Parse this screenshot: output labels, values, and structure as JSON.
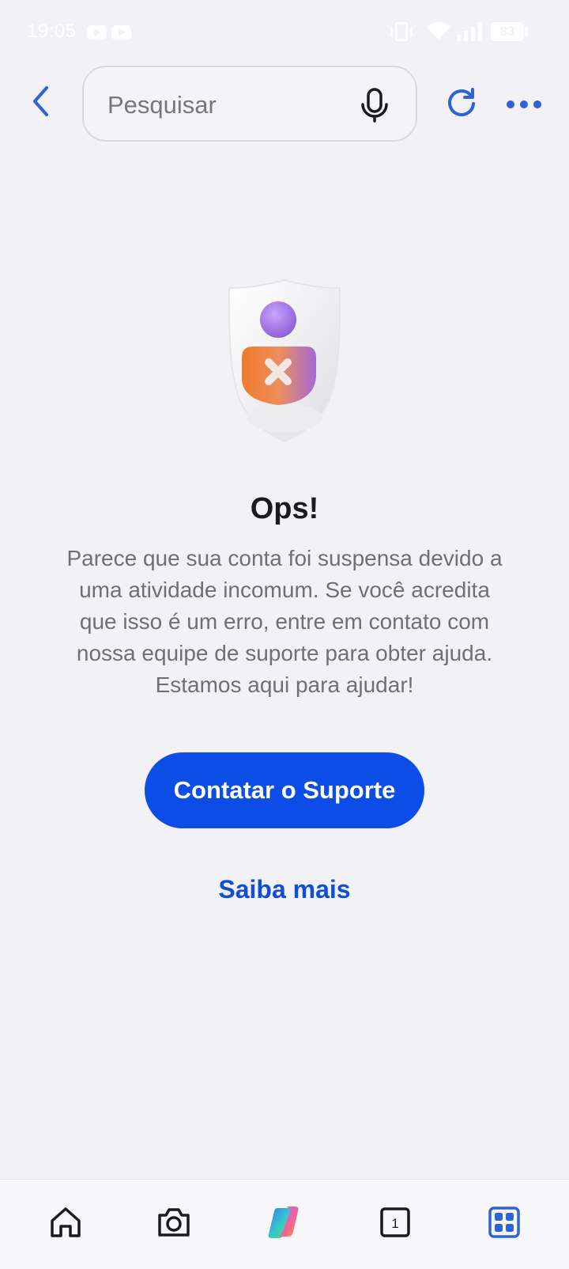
{
  "status_bar": {
    "time": "19:05",
    "battery": "83",
    "icons": [
      "youtube-icon",
      "youtube-icon",
      "vibrate-icon",
      "wifi-icon",
      "signal-icon",
      "battery-icon"
    ]
  },
  "top_bar": {
    "back_icon": "chevron-left-icon",
    "search_placeholder": "Pesquisar",
    "mic_icon": "microphone-icon",
    "refresh_icon": "refresh-icon",
    "more_icon": "more-horizontal-icon"
  },
  "error": {
    "illustration": "shield-blocked-user-icon",
    "title": "Ops!",
    "message": "Parece que sua conta foi suspensa devido a uma atividade incomum. Se você acredita que isso é um erro, entre em contato com nossa equipe de suporte para obter ajuda. Estamos aqui para ajudar!",
    "primary_button": "Contatar o Suporte",
    "link": "Saiba mais"
  },
  "bottom_nav": {
    "items": [
      {
        "icon": "home-icon"
      },
      {
        "icon": "camera-icon"
      },
      {
        "icon": "copilot-icon"
      },
      {
        "icon": "tabs-icon",
        "count": "1"
      },
      {
        "icon": "apps-grid-icon"
      }
    ]
  },
  "colors": {
    "accent": "#0c4de7",
    "icon_blue": "#2f62d6",
    "background": "#f1f1f6",
    "text_secondary": "#6f6f78"
  }
}
